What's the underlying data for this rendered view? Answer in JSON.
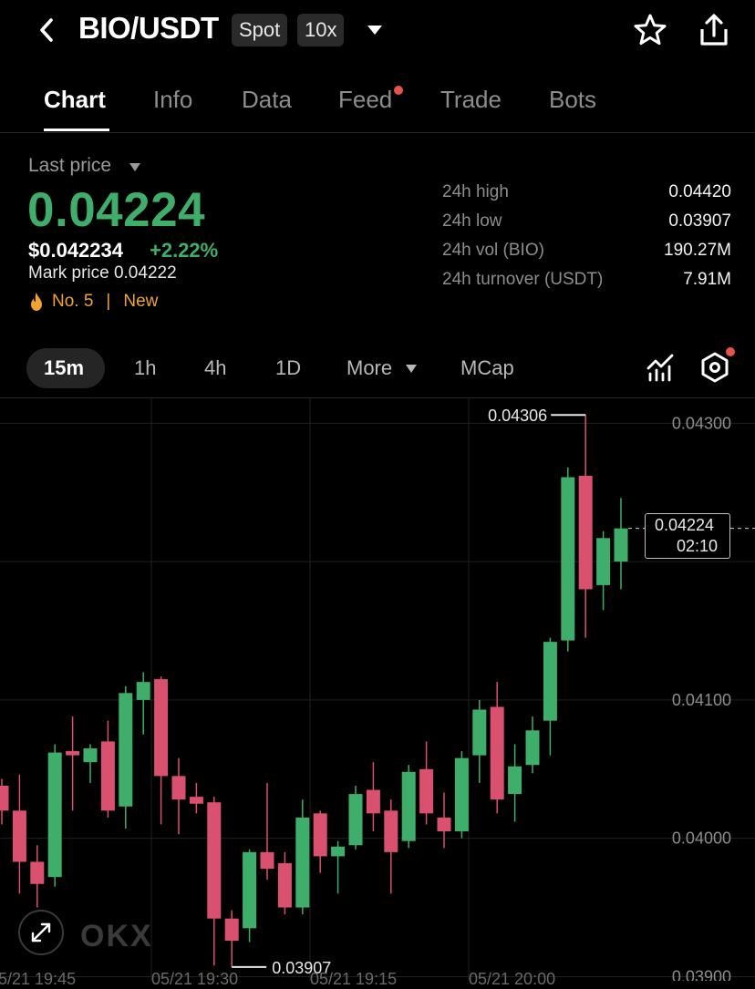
{
  "header": {
    "title": "BIO/USDT",
    "badge_spot": "Spot",
    "badge_leverage": "10x",
    "icons": [
      "back-icon",
      "dropdown-icon",
      "star-icon",
      "share-icon"
    ]
  },
  "tabs": [
    {
      "label": "Chart",
      "active": true
    },
    {
      "label": "Info",
      "active": false
    },
    {
      "label": "Data",
      "active": false
    },
    {
      "label": "Feed",
      "active": false,
      "notification_dot": true
    },
    {
      "label": "Trade",
      "active": false
    },
    {
      "label": "Bots",
      "active": false
    }
  ],
  "price": {
    "last_price_label": "Last price",
    "last_price": "0.04224",
    "usd_price": "$0.042234",
    "change": "+2.22%",
    "mark_price": "Mark price 0.04222",
    "rank": "No. 5",
    "new_tag": "New"
  },
  "stats": [
    {
      "label": "24h high",
      "value": "0.04420"
    },
    {
      "label": "24h low",
      "value": "0.03907"
    },
    {
      "label": "24h vol (BIO)",
      "value": "190.27M"
    },
    {
      "label": "24h turnover (USDT)",
      "value": "7.91M"
    }
  ],
  "timeframes": [
    {
      "label": "15m",
      "active": true
    },
    {
      "label": "1h",
      "active": false
    },
    {
      "label": "4h",
      "active": false
    },
    {
      "label": "1D",
      "active": false
    },
    {
      "label": "More",
      "active": false
    },
    {
      "label": "MCap",
      "active": false
    }
  ],
  "colors": {
    "up": "#3fae6a",
    "down": "#d9516f",
    "accent_dot": "#e5534b"
  },
  "chart_overlay": {
    "current_price": "0.04224",
    "countdown": "02:10",
    "peak_label": "0.04306",
    "low_label": "0.03907",
    "watermark": "OKX"
  },
  "chart_data": {
    "type": "candlestick",
    "ylim": [
      0.03897,
      0.04318
    ],
    "y_ticks": [
      "0.04300",
      "0.04100",
      "0.04000",
      "0.03900"
    ],
    "grid": true,
    "candles": [
      {
        "o": 0.04038,
        "h": 0.04043,
        "l": 0.0401,
        "c": 0.0402
      },
      {
        "o": 0.0402,
        "h": 0.04046,
        "l": 0.0396,
        "c": 0.03983
      },
      {
        "o": 0.03983,
        "h": 0.03995,
        "l": 0.0395,
        "c": 0.03967
      },
      {
        "o": 0.03972,
        "h": 0.04068,
        "l": 0.03965,
        "c": 0.04062
      },
      {
        "o": 0.04063,
        "h": 0.04088,
        "l": 0.0402,
        "c": 0.0406
      },
      {
        "o": 0.04055,
        "h": 0.04068,
        "l": 0.0404,
        "c": 0.04065
      },
      {
        "o": 0.0407,
        "h": 0.04085,
        "l": 0.04015,
        "c": 0.0402
      },
      {
        "o": 0.04023,
        "h": 0.0411,
        "l": 0.04007,
        "c": 0.04105
      },
      {
        "o": 0.041,
        "h": 0.0412,
        "l": 0.04075,
        "c": 0.04113
      },
      {
        "o": 0.04115,
        "h": 0.04117,
        "l": 0.0401,
        "c": 0.04045
      },
      {
        "o": 0.04045,
        "h": 0.04058,
        "l": 0.04003,
        "c": 0.04028
      },
      {
        "o": 0.0403,
        "h": 0.0404,
        "l": 0.04018,
        "c": 0.04025
      },
      {
        "o": 0.04026,
        "h": 0.0403,
        "l": 0.03908,
        "c": 0.03942
      },
      {
        "o": 0.03942,
        "h": 0.03948,
        "l": 0.03907,
        "c": 0.03926
      },
      {
        "o": 0.03935,
        "h": 0.03992,
        "l": 0.03925,
        "c": 0.0399
      },
      {
        "o": 0.0399,
        "h": 0.0404,
        "l": 0.0397,
        "c": 0.03978
      },
      {
        "o": 0.03982,
        "h": 0.0399,
        "l": 0.03945,
        "c": 0.0395
      },
      {
        "o": 0.0395,
        "h": 0.04028,
        "l": 0.03945,
        "c": 0.04015
      },
      {
        "o": 0.04018,
        "h": 0.0402,
        "l": 0.03975,
        "c": 0.03987
      },
      {
        "o": 0.03987,
        "h": 0.03998,
        "l": 0.0396,
        "c": 0.03994
      },
      {
        "o": 0.03995,
        "h": 0.04038,
        "l": 0.03992,
        "c": 0.04032
      },
      {
        "o": 0.04035,
        "h": 0.04055,
        "l": 0.04005,
        "c": 0.04018
      },
      {
        "o": 0.0402,
        "h": 0.04028,
        "l": 0.0396,
        "c": 0.0399
      },
      {
        "o": 0.03998,
        "h": 0.04053,
        "l": 0.03993,
        "c": 0.04048
      },
      {
        "o": 0.0405,
        "h": 0.0407,
        "l": 0.0401,
        "c": 0.04018
      },
      {
        "o": 0.04015,
        "h": 0.04033,
        "l": 0.03993,
        "c": 0.04005
      },
      {
        "o": 0.04005,
        "h": 0.04063,
        "l": 0.04,
        "c": 0.04058
      },
      {
        "o": 0.0406,
        "h": 0.041,
        "l": 0.0404,
        "c": 0.04093
      },
      {
        "o": 0.04095,
        "h": 0.04113,
        "l": 0.04018,
        "c": 0.04028
      },
      {
        "o": 0.04032,
        "h": 0.04068,
        "l": 0.04012,
        "c": 0.04052
      },
      {
        "o": 0.04053,
        "h": 0.04088,
        "l": 0.04047,
        "c": 0.04078
      },
      {
        "o": 0.04085,
        "h": 0.04145,
        "l": 0.0406,
        "c": 0.04142
      },
      {
        "o": 0.04143,
        "h": 0.04268,
        "l": 0.04135,
        "c": 0.04261
      },
      {
        "o": 0.04262,
        "h": 0.04306,
        "l": 0.04145,
        "c": 0.0418
      },
      {
        "o": 0.04183,
        "h": 0.04222,
        "l": 0.04165,
        "c": 0.04217
      },
      {
        "o": 0.042,
        "h": 0.04246,
        "l": 0.0418,
        "c": 0.04224
      }
    ]
  },
  "time_axis": [
    "5/21 19:45",
    "05/21 19:30",
    "05/21 19:15",
    "05/21 20:00"
  ]
}
